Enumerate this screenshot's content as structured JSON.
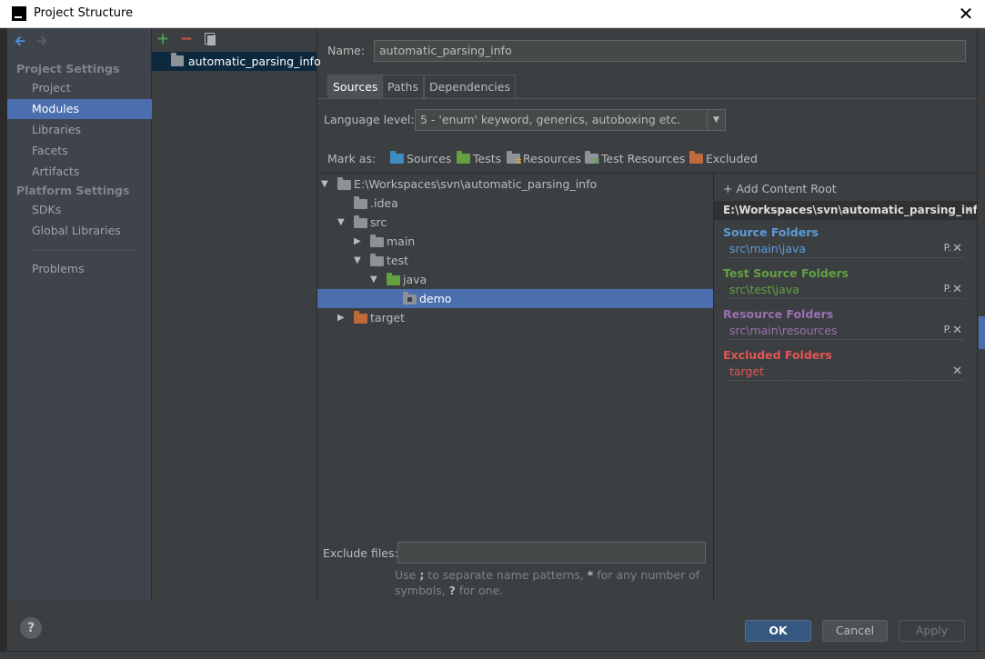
{
  "window": {
    "title": "Project Structure",
    "close": "✕"
  },
  "nav": {
    "back": "🡰",
    "forward": "🡲",
    "sections": [
      {
        "label": "Project Settings"
      },
      {
        "label": "Platform Settings"
      }
    ],
    "items": [
      {
        "label": "Project"
      },
      {
        "label": "Modules"
      },
      {
        "label": "Libraries"
      },
      {
        "label": "Facets"
      },
      {
        "label": "Artifacts"
      },
      {
        "label": "SDKs"
      },
      {
        "label": "Global Libraries"
      },
      {
        "label": "Problems"
      }
    ]
  },
  "modules": {
    "add": "+",
    "remove": "−",
    "items": [
      {
        "label": "automatic_parsing_info"
      }
    ]
  },
  "main": {
    "name_label": "Name:",
    "name_value": "automatic_parsing_info",
    "tabs": [
      {
        "label": "Sources"
      },
      {
        "label": "Paths"
      },
      {
        "label": "Dependencies"
      }
    ],
    "language_label": "Language level:",
    "language_value": "5 - 'enum' keyword, generics, autoboxing etc.",
    "mark_as_label": "Mark as:",
    "mark_as": [
      {
        "label": "Sources"
      },
      {
        "label": "Tests"
      },
      {
        "label": "Resources"
      },
      {
        "label": "Test Resources"
      },
      {
        "label": "Excluded"
      }
    ],
    "tree": [
      {
        "label": "E:\\Workspaces\\svn\\automatic_parsing_info",
        "toggle": "▼"
      },
      {
        "label": ".idea"
      },
      {
        "label": "src",
        "toggle": "▼"
      },
      {
        "label": "main",
        "toggle": "▶"
      },
      {
        "label": "test",
        "toggle": "▼"
      },
      {
        "label": "java",
        "toggle": "▼"
      },
      {
        "label": "demo"
      },
      {
        "label": "target",
        "toggle": "▶"
      }
    ],
    "exclude_label": "Exclude files:",
    "exclude_value": "",
    "hint_part1": "Use ",
    "hint_sep": ";",
    "hint_part2": " to separate name patterns, ",
    "hint_star": "*",
    "hint_part3": " for any number of symbols, ",
    "hint_q": "?",
    "hint_part4": " for one."
  },
  "content_root": {
    "add_label": "+ Add Content Root",
    "path": "E:\\Workspaces\\svn\\automatic_parsing_info",
    "remove": "✕",
    "sections": [
      {
        "heading": "Source Folders",
        "item": "src\\main\\java",
        "color": "#5c9bdb",
        "item_color": "#5c9bdb",
        "ctrl": "P."
      },
      {
        "heading": "Test Source Folders",
        "item": "src\\test\\java",
        "color": "#62a042",
        "item_color": "#62a042",
        "ctrl": "P."
      },
      {
        "heading": "Resource Folders",
        "item": "src\\main\\resources",
        "color": "#9a6fb0",
        "item_color": "#9a6fb0",
        "ctrl": "P."
      },
      {
        "heading": "Excluded Folders",
        "item": "target",
        "color": "#e05555",
        "item_color": "#e05555",
        "ctrl": ""
      }
    ]
  },
  "buttons": {
    "help": "?",
    "ok": "OK",
    "cancel": "Cancel",
    "apply": "Apply"
  },
  "colors": {
    "selection": "#4b6eaf",
    "background": "#3c3f41",
    "sidebar": "#3e434c"
  }
}
